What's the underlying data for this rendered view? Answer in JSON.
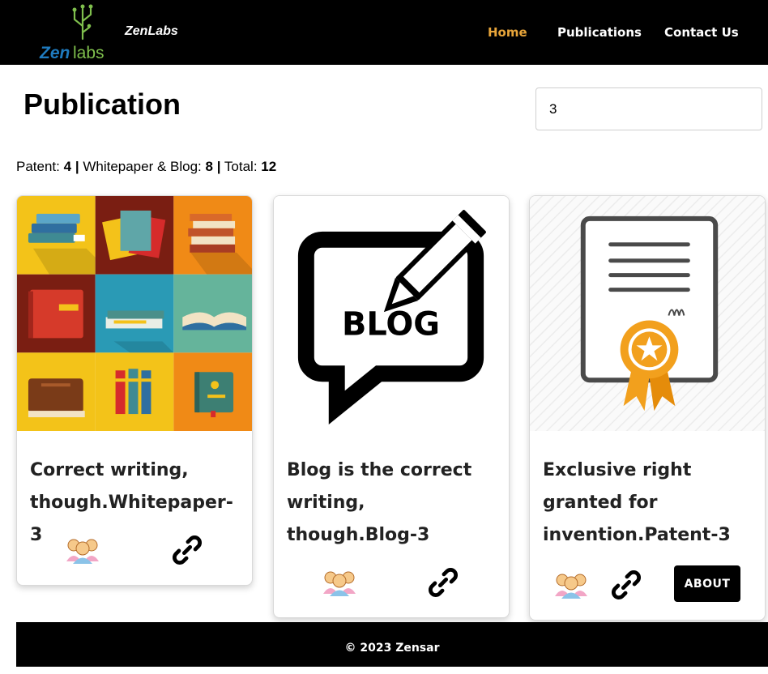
{
  "navbar": {
    "brand": "ZenLabs",
    "logo_text": "Zenlabs",
    "links": [
      {
        "label": "Home",
        "active": true
      },
      {
        "label": "Publications",
        "active": false
      },
      {
        "label": "Contact Us",
        "active": false
      }
    ],
    "active_color": "#e8a53a"
  },
  "main": {
    "title": "Publication",
    "search_value": "3",
    "stats": {
      "patent_label": "Patent:",
      "patent_count": "4",
      "whitepaper_label": "Whitepaper & Blog:",
      "whitepaper_count": "8",
      "total_label": "Total:",
      "total_count": "12",
      "separator": "|"
    }
  },
  "cards": [
    {
      "title": "Correct writing, though.Whitepaper-3",
      "image": "books-collage",
      "icons": [
        "users-icon",
        "link-icon"
      ]
    },
    {
      "title": "Blog is the correct writing, though.Blog-3",
      "image": "blog-speech-bubble",
      "image_text": "BLOG",
      "icons": [
        "users-icon",
        "link-icon"
      ]
    },
    {
      "title": "Exclusive right granted for invention.Patent-3",
      "image": "patent-certificate",
      "icons": [
        "users-icon",
        "link-icon"
      ],
      "button_label": "ABOUT"
    }
  ],
  "footer": {
    "text": "© 2023 Zensar"
  }
}
